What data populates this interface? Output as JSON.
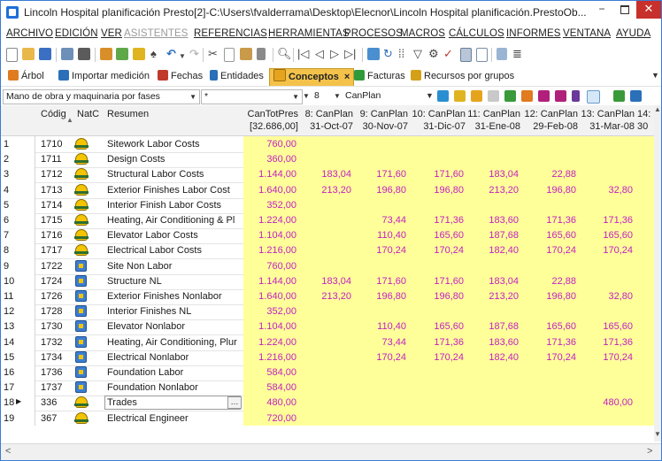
{
  "window": {
    "title": "Lincoln Hospital planificación Presto[2]-C:\\Users\\fvalderrama\\Desktop\\Elecnor\\Lincoln Hospital planificación.PrestoOb...",
    "minimize": "−",
    "close": "✕"
  },
  "menu": [
    "ARCHIVO",
    "EDICIÓN",
    "VER",
    "ASISTENTES",
    "REFERENCIAS",
    "HERRAMIENTAS",
    "PROCESOS",
    "MACROS",
    "CÁLCULOS",
    "INFORMES",
    "VENTANA",
    "AYUDA"
  ],
  "tabs": [
    {
      "label": "Árbol",
      "icon": "tree-icon",
      "color": "#e07b20"
    },
    {
      "label": "Importar medición",
      "icon": "import-icon",
      "color": "#2a6fb8"
    },
    {
      "label": "Fechas",
      "icon": "calendar-icon",
      "color": "#c03a2b"
    },
    {
      "label": "Entidades",
      "icon": "person-icon",
      "color": "#2a6fb8"
    },
    {
      "label": "Conceptos",
      "icon": "concepts-icon",
      "color": "#e6a41e",
      "active": true,
      "close": "×"
    },
    {
      "label": "Facturas",
      "icon": "invoice-icon",
      "color": "#2f9a3a"
    },
    {
      "label": "Recursos por grupos",
      "icon": "group-icon",
      "color": "#d4a017"
    }
  ],
  "filters": {
    "scheme": "Mano de obra y maquinaria por fases",
    "mask": "*",
    "level": "8",
    "field": "CanPlan"
  },
  "columns": {
    "codigo": "Códig",
    "natc": "NatC",
    "resumen": "Resumen",
    "cantotpres": [
      "CanTotPres",
      "[32.686,00]"
    ],
    "periods": [
      [
        "8: CanPlan",
        "31-Oct-07"
      ],
      [
        "9: CanPlan",
        "30-Nov-07"
      ],
      [
        "10: CanPlan",
        "31-Dic-07"
      ],
      [
        "11: CanPlan",
        "31-Ene-08"
      ],
      [
        "12: CanPlan",
        "29-Feb-08"
      ],
      [
        "13: CanPlan",
        "31-Mar-08"
      ],
      [
        "14:",
        "30"
      ]
    ]
  },
  "rows": [
    {
      "n": "1",
      "code": "1710",
      "type": "labor",
      "summary": "Sitework Labor Costs",
      "total": "760,00",
      "p": [
        "",
        "",
        "",
        "",
        "",
        ""
      ]
    },
    {
      "n": "2",
      "code": "1711",
      "type": "labor",
      "summary": "Design Costs",
      "total": "360,00",
      "p": [
        "",
        "",
        "",
        "",
        "",
        ""
      ]
    },
    {
      "n": "3",
      "code": "1712",
      "type": "labor",
      "summary": "Structural Labor Costs",
      "total": "1.144,00",
      "p": [
        "183,04",
        "171,60",
        "171,60",
        "183,04",
        "22,88",
        ""
      ]
    },
    {
      "n": "4",
      "code": "1713",
      "type": "labor",
      "summary": "Exterior Finishes Labor Cost",
      "total": "1.640,00",
      "p": [
        "213,20",
        "196,80",
        "196,80",
        "213,20",
        "196,80",
        "32,80"
      ]
    },
    {
      "n": "5",
      "code": "1714",
      "type": "labor",
      "summary": "Interior Finish Labor Costs",
      "total": "352,00",
      "p": [
        "",
        "",
        "",
        "",
        "",
        ""
      ]
    },
    {
      "n": "6",
      "code": "1715",
      "type": "labor",
      "summary": "Heating, Air Conditioning & Pl",
      "total": "1.224,00",
      "p": [
        "",
        "73,44",
        "171,36",
        "183,60",
        "171,36",
        "171,36"
      ]
    },
    {
      "n": "7",
      "code": "1716",
      "type": "labor",
      "summary": "Elevator Labor Costs",
      "total": "1.104,00",
      "p": [
        "",
        "110,40",
        "165,60",
        "187,68",
        "165,60",
        "165,60"
      ]
    },
    {
      "n": "8",
      "code": "1717",
      "type": "labor",
      "summary": "Electrical Labor Costs",
      "total": "1.216,00",
      "p": [
        "",
        "170,24",
        "170,24",
        "182,40",
        "170,24",
        "170,24"
      ]
    },
    {
      "n": "9",
      "code": "1722",
      "type": "nonlabor",
      "summary": "Site Non Labor",
      "total": "760,00",
      "p": [
        "",
        "",
        "",
        "",
        "",
        ""
      ]
    },
    {
      "n": "10",
      "code": "1724",
      "type": "nonlabor",
      "summary": "Structure NL",
      "total": "1.144,00",
      "p": [
        "183,04",
        "171,60",
        "171,60",
        "183,04",
        "22,88",
        ""
      ]
    },
    {
      "n": "11",
      "code": "1726",
      "type": "nonlabor",
      "summary": "Exterior Finishes Nonlabor",
      "total": "1.640,00",
      "p": [
        "213,20",
        "196,80",
        "196,80",
        "213,20",
        "196,80",
        "32,80"
      ]
    },
    {
      "n": "12",
      "code": "1728",
      "type": "nonlabor",
      "summary": "Interior Finishes NL",
      "total": "352,00",
      "p": [
        "",
        "",
        "",
        "",
        "",
        ""
      ]
    },
    {
      "n": "13",
      "code": "1730",
      "type": "nonlabor",
      "summary": "Elevator Nonlabor",
      "total": "1.104,00",
      "p": [
        "",
        "110,40",
        "165,60",
        "187,68",
        "165,60",
        "165,60"
      ]
    },
    {
      "n": "14",
      "code": "1732",
      "type": "nonlabor",
      "summary": "Heating, Air Conditioning, Plur",
      "total": "1.224,00",
      "p": [
        "",
        "73,44",
        "171,36",
        "183,60",
        "171,36",
        "171,36"
      ]
    },
    {
      "n": "15",
      "code": "1734",
      "type": "nonlabor",
      "summary": "Electrical Nonlabor",
      "total": "1.216,00",
      "p": [
        "",
        "170,24",
        "170,24",
        "182,40",
        "170,24",
        "170,24"
      ]
    },
    {
      "n": "16",
      "code": "1736",
      "type": "nonlabor",
      "summary": "Foundation Labor",
      "total": "584,00",
      "p": [
        "",
        "",
        "",
        "",
        "",
        ""
      ]
    },
    {
      "n": "17",
      "code": "1737",
      "type": "nonlabor",
      "summary": "Foundation Nonlabor",
      "total": "584,00",
      "p": [
        "",
        "",
        "",
        "",
        "",
        ""
      ]
    },
    {
      "n": "18",
      "code": "336",
      "type": "labor",
      "summary": "Trades",
      "total": "480,00",
      "p": [
        "",
        "",
        "",
        "",
        "",
        "480,00"
      ],
      "current": true
    },
    {
      "n": "19",
      "code": "367",
      "type": "labor",
      "summary": "Electrical Engineer",
      "total": "720,00",
      "p": [
        "",
        "",
        "",
        "",
        "",
        ""
      ]
    }
  ],
  "scroll": {
    "left": "<",
    "right": ">"
  }
}
